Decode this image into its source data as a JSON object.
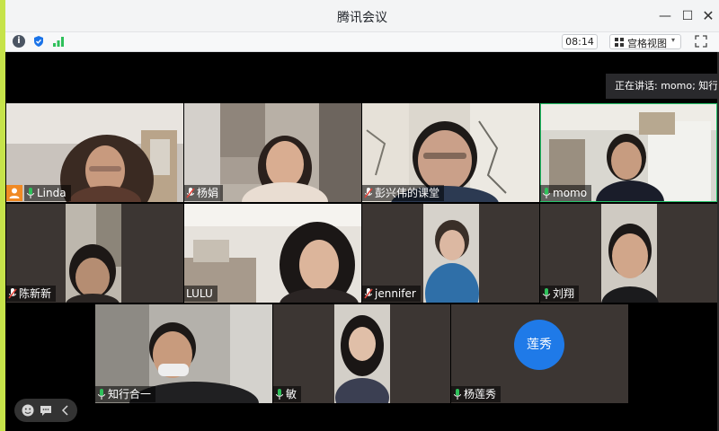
{
  "window": {
    "title": "腾讯会议",
    "minimize": "—",
    "maximize": "☐",
    "close": "✕"
  },
  "toolbar": {
    "time": "08:14",
    "view_label": "宫格视图",
    "view_caret": "▾",
    "info_glyph": "i",
    "icons": [
      "info-icon",
      "shield-icon",
      "signal-icon",
      "grid-icon",
      "fullscreen-icon"
    ]
  },
  "speaking": {
    "text": "正在讲话: momo; 知行合一"
  },
  "participants": [
    {
      "name": "Linda",
      "mic": "on",
      "host": true
    },
    {
      "name": "杨娟",
      "mic": "muted"
    },
    {
      "name": "彭兴伟的课堂",
      "mic": "muted"
    },
    {
      "name": "momo",
      "mic": "on",
      "speaking": true
    },
    {
      "name": "陈新新",
      "mic": "muted"
    },
    {
      "name": "LULU",
      "mic": "none"
    },
    {
      "name": "jennifer",
      "mic": "muted"
    },
    {
      "name": "刘翔",
      "mic": "on"
    },
    {
      "name": "知行合一",
      "mic": "on"
    },
    {
      "name": "敏",
      "mic": "on"
    },
    {
      "name": "杨莲秀",
      "mic": "on",
      "avatar_text": "莲秀",
      "avatar_color": "#1f7ae8"
    }
  ],
  "colors": {
    "mic_on": "#2ec05a",
    "mic_muted": "#e0443a",
    "avatar": "#1f7ae8",
    "host": "#f08a24",
    "left_strip": "#c6e34a"
  }
}
